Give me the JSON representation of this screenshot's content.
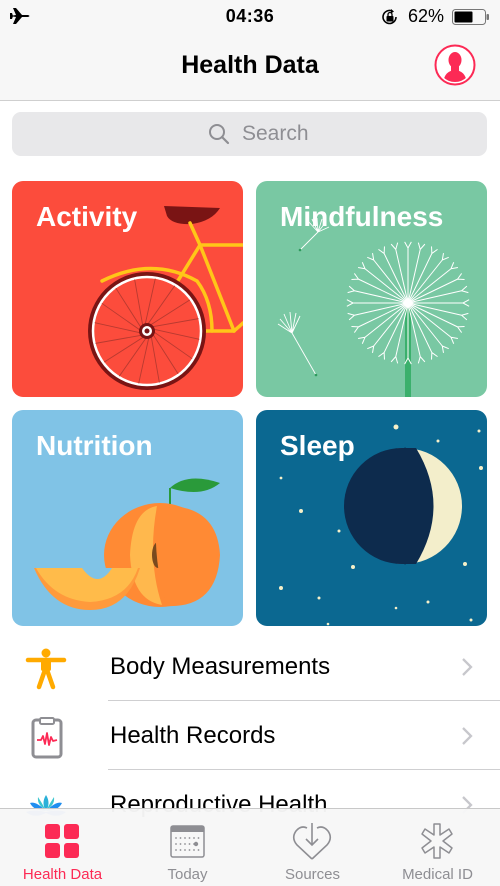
{
  "status_bar": {
    "time": "04:36",
    "battery_percent_label": "62%",
    "battery_level": 0.62,
    "icons": [
      "airplane-mode-icon",
      "rotation-lock-icon",
      "battery-icon"
    ]
  },
  "nav": {
    "title": "Health Data",
    "profile_icon": "profile-icon"
  },
  "search": {
    "placeholder": "Search"
  },
  "tiles": [
    {
      "label": "Activity",
      "color": "#fc4c3c"
    },
    {
      "label": "Mindfulness",
      "color": "#79c8a3"
    },
    {
      "label": "Nutrition",
      "color": "#80c3e6"
    },
    {
      "label": "Sleep",
      "color": "#0b6891"
    }
  ],
  "list": [
    {
      "label": "Body Measurements",
      "icon": "body-figure-icon"
    },
    {
      "label": "Health Records",
      "icon": "clipboard-icon"
    },
    {
      "label": "Reproductive Health",
      "icon": "lotus-icon"
    }
  ],
  "tabs": [
    {
      "label": "Health Data",
      "icon": "grid-icon",
      "active": true
    },
    {
      "label": "Today",
      "icon": "calendar-icon",
      "active": false
    },
    {
      "label": "Sources",
      "icon": "heart-download-icon",
      "active": false
    },
    {
      "label": "Medical ID",
      "icon": "asterisk-icon",
      "active": false
    }
  ],
  "colors": {
    "accent": "#fc2a55",
    "inactive_tab": "#8e8e93",
    "body_icon": "#ffaa00"
  }
}
